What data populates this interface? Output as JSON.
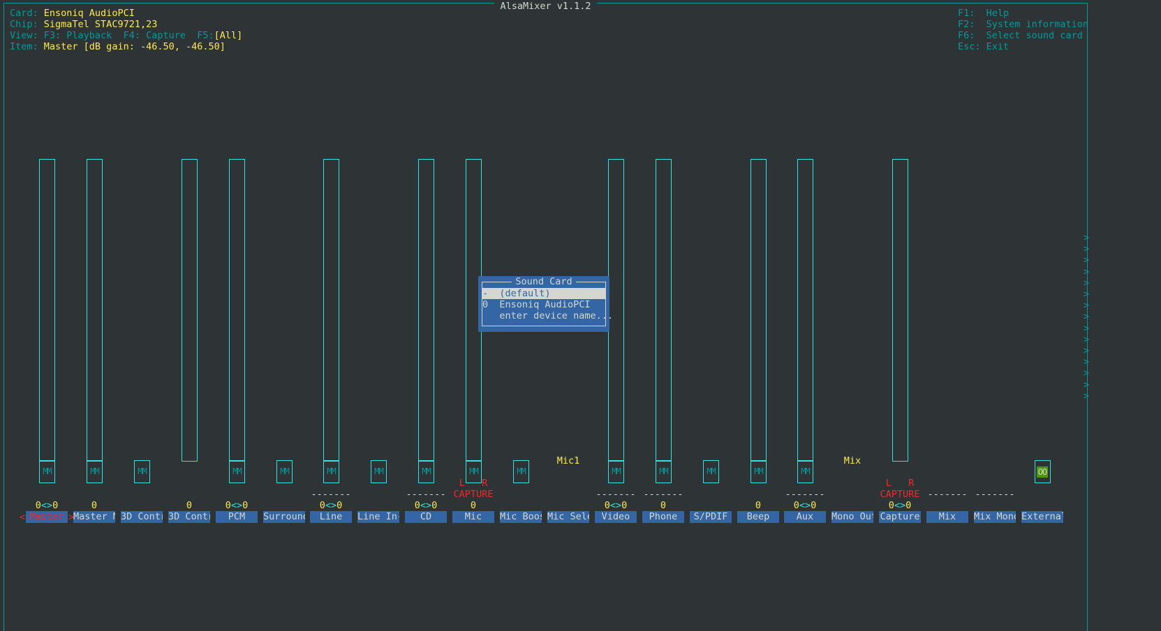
{
  "window": {
    "title": "AlsaMixer v1.1.2"
  },
  "info": {
    "card_label": "Card:",
    "card_value": "Ensoniq AudioPCI",
    "chip_label": "Chip:",
    "chip_value": "SigmaTel STAC9721,23",
    "view_label": "View:",
    "view_playback": "F3: Playback",
    "view_capture": "F4: Capture",
    "view_all_key": "F5:",
    "view_all": "[All]",
    "item_label": "Item:",
    "item_value": "Master [dB gain: -46.50, -46.50]"
  },
  "help": [
    {
      "key": "F1:",
      "label": "Help"
    },
    {
      "key": "F2:",
      "label": "System information"
    },
    {
      "key": "F6:",
      "label": "Select sound card"
    },
    {
      "key": "Esc:",
      "label": "Exit"
    }
  ],
  "colors": {
    "background": "#2e3436",
    "bar": "#34e2e2",
    "accent": "#06989a",
    "value": "#fce94f",
    "label_bg": "#3465a4",
    "capture": "#ef2929",
    "switch_on": "#4e9a06"
  },
  "controls": [
    {
      "label": "Master",
      "selected": true,
      "bar": true,
      "mute": "MM",
      "value": "0<>0",
      "level": 0
    },
    {
      "label": "Master M",
      "bar": true,
      "mute": "MM",
      "value": "0",
      "level": 0
    },
    {
      "label": "3D Contr",
      "mute": "MM"
    },
    {
      "label": "3D Contr",
      "bar": true,
      "value": "0",
      "level": 0
    },
    {
      "label": "PCM",
      "bar": true,
      "mute": "MM",
      "value": "0<>0",
      "level": 0
    },
    {
      "label": "Surround",
      "mute": "MM"
    },
    {
      "label": "Line",
      "bar": true,
      "mute": "MM",
      "dashes": "-------",
      "value": "0<>0",
      "level": 0
    },
    {
      "label": "Line In-",
      "mute": "MM"
    },
    {
      "label": "CD",
      "bar": true,
      "mute": "MM",
      "dashes": "-------",
      "value": "0<>0",
      "level": 0
    },
    {
      "label": "Mic",
      "bar": true,
      "mute": "MM",
      "capture_lr": "L   R",
      "capture": "CAPTURE",
      "value": "0",
      "level": 0
    },
    {
      "label": "Mic Boos",
      "mute": "MM"
    },
    {
      "label": "Mic Sele",
      "enum": "Mic1"
    },
    {
      "label": "Video",
      "bar": true,
      "mute": "MM",
      "dashes": "-------",
      "value": "0<>0",
      "level": 0
    },
    {
      "label": "Phone",
      "bar": true,
      "mute": "MM",
      "dashes": "-------",
      "value": "0",
      "level": 0
    },
    {
      "label": "S/PDIF",
      "mute": "MM"
    },
    {
      "label": "Beep",
      "bar": true,
      "mute": "MM",
      "value": "0",
      "level": 0
    },
    {
      "label": "Aux",
      "bar": true,
      "mute": "MM",
      "dashes": "-------",
      "value": "0<>0",
      "level": 0
    },
    {
      "label": "Mono Out",
      "enum": "Mix"
    },
    {
      "label": "Capture",
      "bar": true,
      "capture_lr": "L   R",
      "capture": "CAPTURE",
      "value": "0<>0",
      "level": 0
    },
    {
      "label": "Mix",
      "dashes": "-------"
    },
    {
      "label": "Mix Mono",
      "dashes": "-------"
    },
    {
      "label": "External",
      "switch": "OO"
    }
  ],
  "scroll_indicator": ">",
  "dialog": {
    "title": "Sound Card",
    "items": [
      {
        "index": "-",
        "name": "(default)",
        "selected": true
      },
      {
        "index": "0",
        "name": "Ensoniq AudioPCI"
      },
      {
        "index": " ",
        "name": "enter device name..."
      }
    ]
  }
}
